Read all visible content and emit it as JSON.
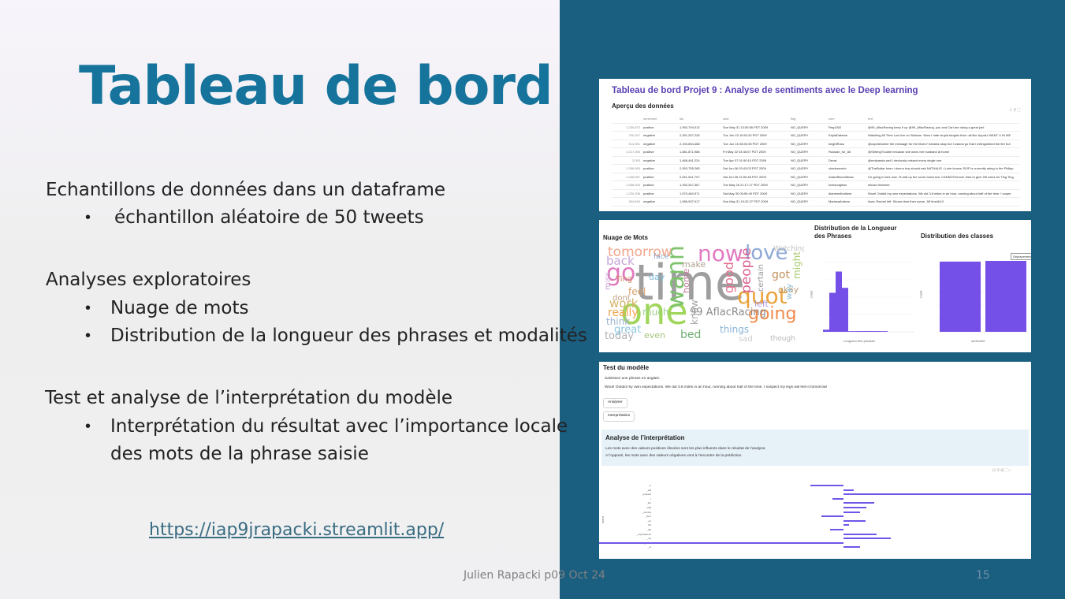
{
  "slide": {
    "title": "Tableau de bord",
    "sections": [
      {
        "heading": "Echantillons de données dans un dataframe",
        "bullets": [
          "échantillon aléatoire de 50 tweets"
        ]
      },
      {
        "heading": "Analyses exploratoires",
        "bullets": [
          "Nuage de mots",
          "Distribution de la longueur des phrases et modalités"
        ]
      },
      {
        "heading": "Test et analyse de l’interprétation du modèle",
        "bullets": [
          "Interprétation du résultat avec l’importance locale",
          "des mots de la phrase saisie"
        ]
      }
    ],
    "link": "https://iap9jrapacki.streamlit.app/",
    "footer": "Julien Rapacki p09 Oct 24",
    "page_number": "15"
  },
  "screenshot1": {
    "title": "Tableau de bord Projet 9 : Analyse de sentiments avec le Deep learning",
    "subheading": "Aperçu des données",
    "columns": [
      "",
      "sentiment",
      "ids",
      "date",
      "flag",
      "user",
      "text"
    ],
    "rows": [
      [
        "1,230,872",
        "positive",
        "1,992,794,012",
        "Sun May 31 13:50:55 PDT 2009",
        "NO_QUERY",
        "Reg1002",
        "@99_AflacRacing keep it up @99_AflacRacing, you and Carl are doing a great job!"
      ],
      [
        "790,207",
        "negative",
        "2,391,257,226",
        "Tue Jun 23 15:52:20 PDT 2009",
        "NO_QUERY",
        "KaylaDafame",
        "Watching All Time Low live on Stickam. Wow I hate stupid fangirls that r all like &quot;I WANT U IN ME"
      ],
      [
        "514,951",
        "negative",
        "2,193,654,468",
        "Tue Jun 16 08:40:35 PDT 2009",
        "NO_QUERY",
        "knightRoss",
        "@cupidsholme the message for the blues? hahaha okay but I wanna go that  i extinguished the fire but"
      ],
      [
        "1,017,394",
        "positive",
        "1,881,871,988",
        "Fri May 22 03:45:07 PDT 2009",
        "NO_QUERY",
        "Russian_for_All",
        "@StirringTrouble because she owns her husband at home"
      ],
      [
        "2,093",
        "negative",
        "1,468,461,224",
        "Tue Apr 07 01:50:10 PDT 2009",
        "NO_QUERY",
        "Devar",
        "@emipanda well i obviously missed every single one"
      ],
      [
        "1,396,063",
        "positive",
        "2,053,755,265",
        "Sat Jun 06 03:43:03 PDT 2009",
        "NO_QUERY",
        "charlesworto",
        "@TheBottar hmm i dunno boy should ask NATHALIE =) she knows. BOF is currently airing in the Philipp"
      ],
      [
        "1,436,857",
        "positive",
        "2,061,541,707",
        "Sat Jun 06 21:50:46 PDT 2009",
        "NO_QUERY",
        "AdamBloomMusic",
        "I'm going to bed now. I'll add up the score tomorrow. CANNOTforever tried to give 2M votes for Ting Ting"
      ],
      [
        "1,558,009",
        "positive",
        "1,932,347,367",
        "Tue May 26 21:17:17 PDT 2009",
        "NO_QUERY",
        "lovesongless",
        "whose liveeeee"
      ],
      [
        "1,230,208",
        "positive",
        "1,970,460,971",
        "Sat May 30 00:59:49 PDT 2009",
        "NO_QUERY",
        "dianemulholland",
        "Woot! Outdid my own expectations. We did 3.8 miles in an hour, running about half of the time. I suspe"
      ],
      [
        "264,634",
        "negative",
        "1,986,937,017",
        "Sun May 31 19:32:27 PDT 2009",
        "NO_QUERY",
        "MarissaAndrea",
        "Aww. Rachel left. Shows time then some. Jiff time&lt;3"
      ]
    ],
    "tools": "⇩  ⚲  ⛶"
  },
  "screenshot2": {
    "wordcloud_title": "Nuage de Mots",
    "length_title": "Distribution de la Longueur des Phrases",
    "classes_title": "Distribution des classes",
    "length_xlabel": "Longueur des phrases",
    "length_ylabel": "count",
    "classes_xlabel": "sentiment",
    "classes_ylabel": "count",
    "classes_legend": "Déplacement",
    "words": [
      {
        "t": "time",
        "c": "#9e9e9e"
      },
      {
        "t": "one",
        "c": "#a0d65a"
      },
      {
        "t": "now",
        "c": "#e27ac2"
      },
      {
        "t": "love",
        "c": "#8fa9d6"
      },
      {
        "t": "wanna",
        "c": "#7dc36d"
      },
      {
        "t": "go",
        "c": "#e07abf"
      },
      {
        "t": "quot",
        "c": "#e9a23b"
      },
      {
        "t": "going",
        "c": "#f08a4a"
      },
      {
        "t": "tomorrow",
        "c": "#f2a58a"
      },
      {
        "t": "back",
        "c": "#c7a6d8"
      },
      {
        "t": "work",
        "c": "#d4b36a"
      },
      {
        "t": "99 AflacRacing",
        "c": "#8c8c8c"
      },
      {
        "t": "people",
        "c": "#d95f8f"
      },
      {
        "t": "things",
        "c": "#8ab4d8"
      },
      {
        "t": "today",
        "c": "#b3b3b3"
      },
      {
        "t": "think",
        "c": "#9fb3d1"
      },
      {
        "t": "great",
        "c": "#8cc7e0"
      },
      {
        "t": "bed",
        "c": "#6fae72"
      },
      {
        "t": "know",
        "c": "#a5a5a5"
      },
      {
        "t": "good",
        "c": "#e36f8e"
      },
      {
        "t": "got",
        "c": "#c28f5a"
      },
      {
        "t": "okay",
        "c": "#ba9e7a"
      },
      {
        "t": "really",
        "c": "#f3a44f"
      },
      {
        "t": "much",
        "c": "#9fd08c"
      },
      {
        "t": "feel",
        "c": "#d6a06a"
      },
      {
        "t": "left",
        "c": "#a98fd3"
      },
      {
        "t": "make",
        "c": "#b0a090"
      },
      {
        "t": "sad",
        "c": "#cccccc"
      },
      {
        "t": "day",
        "c": "#7cb8d6"
      },
      {
        "t": "home",
        "c": "#c37a9a"
      },
      {
        "t": "might",
        "c": "#a7c96b"
      },
      {
        "t": "though",
        "c": "#b5b5b5"
      },
      {
        "t": "Watching",
        "c": "#bdbdbd"
      },
      {
        "t": "face",
        "c": "#88a0c0"
      },
      {
        "t": "even",
        "c": "#a3c47b"
      },
      {
        "t": "Ting",
        "c": "#d18c66"
      },
      {
        "t": "certain",
        "c": "#999999"
      },
      {
        "t": "dont",
        "c": "#c0a080"
      },
      {
        "t": "way",
        "c": "#8fbcd8"
      },
      {
        "t": "miss",
        "c": "#c9a4d6"
      }
    ],
    "length_values": [
      0.03,
      0.55,
      0.85,
      0.62,
      0.01,
      0.01,
      0.01
    ],
    "classes_values": [
      0.99,
      1.0
    ]
  },
  "screenshot3": {
    "heading": "Test du modèle",
    "input_label": "Saisissez une phrase en anglais:",
    "input_value": "Woot! Outdid my own expectations. We did 3.8 miles in an hour, running about half of the time. I suspect my legs will feel it tomorrow!",
    "analyze_button": "Analyser",
    "interpret_button": "Interprétation",
    "interp_heading": "Analyse de l’interprétation",
    "interp_line1": "Les mots avec des valeurs positives élevées sont les plus influents dans le résultat de l’analyse.",
    "interp_line2": "A l’opposé, les mots avec des valeurs négatives vont à l’encontre de la prédiction.",
    "chart_tools": "⊡  ⚲  ⊞  ⛶  ⌂",
    "chart_ylabel": "word",
    "words": [
      "_it",
      "_will",
      "_suspect",
      "i",
      "_the",
      "_half",
      "_running",
      "_hour",
      "_an",
      "3.8",
      "_did",
      "_expectations",
      "_my",
      "_Woot",
      "_of"
    ],
    "values": [
      -0.6,
      0.18,
      4.7,
      -0.2,
      0.55,
      0.42,
      0.3,
      -0.4,
      0.4,
      0.1,
      -0.25,
      0.6,
      0.85,
      -5.1,
      0.3
    ]
  }
}
